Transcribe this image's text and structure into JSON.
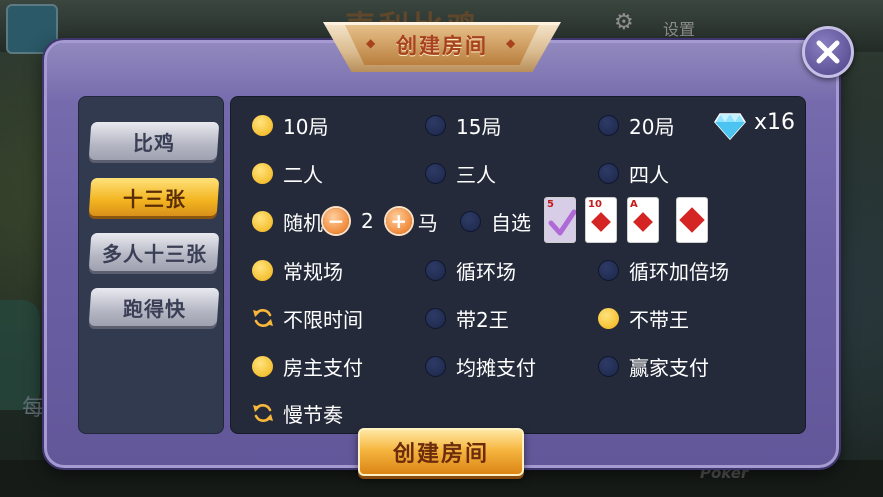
{
  "background": {
    "title": "声利比鸡",
    "settings_label": "设置",
    "side_text": "每",
    "poker_text": "Poker"
  },
  "dialog": {
    "title": "创建房间",
    "create_button": "创建房间"
  },
  "tabs": [
    {
      "label": "比鸡",
      "active": false
    },
    {
      "label": "十三张",
      "active": true
    },
    {
      "label": "多人十三张",
      "active": false
    },
    {
      "label": "跑得快",
      "active": false
    }
  ],
  "cost": {
    "icon": "diamond-icon",
    "count": "x16"
  },
  "rounds": [
    {
      "label": "10局",
      "selected": true
    },
    {
      "label": "15局",
      "selected": false
    },
    {
      "label": "20局",
      "selected": false
    }
  ],
  "players": [
    {
      "label": "二人",
      "selected": true
    },
    {
      "label": "三人",
      "selected": false
    },
    {
      "label": "四人",
      "selected": false
    }
  ],
  "horse": {
    "random_label": "随机",
    "random_selected": true,
    "count": "2",
    "unit": "马",
    "custom_label": "自选",
    "custom_selected": false,
    "cards": [
      {
        "rank": "5",
        "selected": true
      },
      {
        "rank": "10",
        "selected": false
      },
      {
        "rank": "A",
        "selected": false
      },
      {
        "rank": "",
        "selected": false
      }
    ]
  },
  "mode": [
    {
      "label": "常规场",
      "selected": true
    },
    {
      "label": "循环场",
      "selected": false
    },
    {
      "label": "循环加倍场",
      "selected": false
    }
  ],
  "jokers": [
    {
      "label": "不限时间",
      "type": "toggle"
    },
    {
      "label": "带2王",
      "selected": false
    },
    {
      "label": "不带王",
      "selected": true
    }
  ],
  "payment": [
    {
      "label": "房主支付",
      "selected": true
    },
    {
      "label": "均摊支付",
      "selected": false
    },
    {
      "label": "赢家支付",
      "selected": false
    }
  ],
  "tempo": {
    "label": "慢节奏",
    "type": "toggle"
  }
}
